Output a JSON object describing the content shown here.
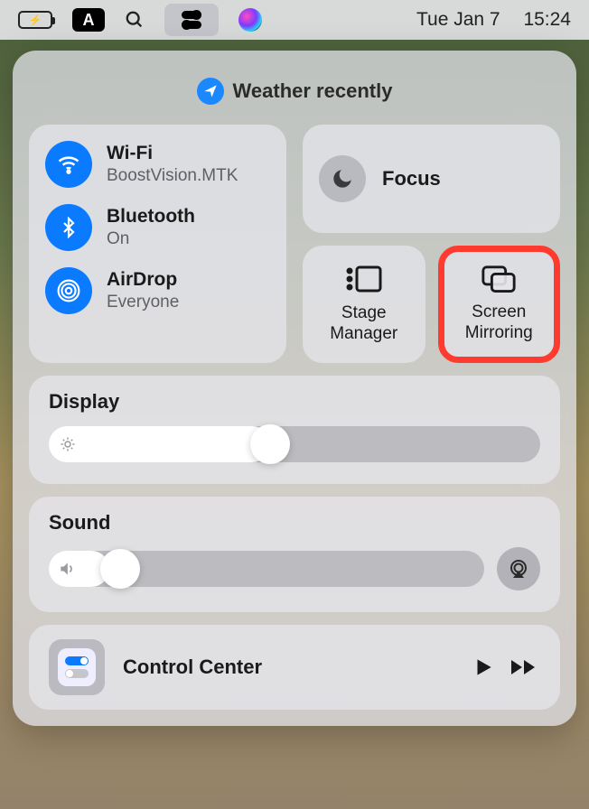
{
  "menubar": {
    "input_source": "A",
    "date": "Tue Jan 7",
    "time": "15:24"
  },
  "header": {
    "location_text": "Weather recently"
  },
  "connectivity": {
    "wifi": {
      "title": "Wi-Fi",
      "subtitle": "BoostVision.MTK"
    },
    "bluetooth": {
      "title": "Bluetooth",
      "subtitle": "On"
    },
    "airdrop": {
      "title": "AirDrop",
      "subtitle": "Everyone"
    }
  },
  "focus": {
    "label": "Focus"
  },
  "stage_manager": {
    "label": "Stage\nManager"
  },
  "screen_mirroring": {
    "label": "Screen\nMirroring"
  },
  "display": {
    "title": "Display",
    "brightness_percent": 45
  },
  "sound": {
    "title": "Sound",
    "volume_percent": 14
  },
  "prefs": {
    "label": "Control Center"
  }
}
